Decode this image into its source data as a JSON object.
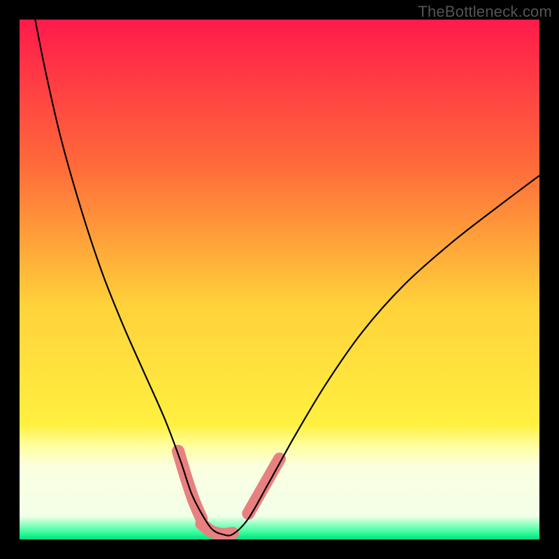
{
  "watermark": "TheBottleneck.com",
  "chart_data": {
    "type": "line",
    "title": "",
    "xlabel": "",
    "ylabel": "",
    "xlim": [
      0,
      100
    ],
    "ylim": [
      0,
      100
    ],
    "grid": false,
    "legend": false,
    "background_gradient": {
      "stops": [
        {
          "offset": 0.0,
          "color": "#ff1a4b"
        },
        {
          "offset": 0.28,
          "color": "#ff6a3a"
        },
        {
          "offset": 0.55,
          "color": "#ffd23a"
        },
        {
          "offset": 0.78,
          "color": "#fff040"
        },
        {
          "offset": 0.82,
          "color": "#ffffa0"
        },
        {
          "offset": 0.86,
          "color": "#fbffe0"
        },
        {
          "offset": 0.955,
          "color": "#f2ffe8"
        },
        {
          "offset": 0.985,
          "color": "#3fffa0"
        },
        {
          "offset": 1.0,
          "color": "#00e080"
        }
      ]
    },
    "series": [
      {
        "name": "bottleneck-curve",
        "color": "#000000",
        "width": 2.2,
        "x": [
          3,
          5,
          8,
          12,
          16,
          20,
          24,
          28,
          31,
          33,
          35,
          37,
          39,
          41,
          44,
          48,
          53,
          59,
          66,
          74,
          83,
          92,
          100
        ],
        "y": [
          100,
          90,
          77,
          63,
          51,
          41,
          32,
          23,
          15,
          9,
          5,
          2,
          1,
          1,
          4,
          11,
          20,
          30,
          40,
          49,
          57,
          64,
          70
        ]
      }
    ],
    "annotations": [
      {
        "name": "highlight-left",
        "type": "thick-segment",
        "color": "#e98080",
        "width": 18,
        "x": [
          30.5,
          32.0,
          33.5,
          35.0
        ],
        "y": [
          17.0,
          12.0,
          7.5,
          4.0
        ]
      },
      {
        "name": "highlight-bottom",
        "type": "thick-segment",
        "color": "#e98080",
        "width": 18,
        "x": [
          35.0,
          37.0,
          39.0,
          41.0
        ],
        "y": [
          3.0,
          1.5,
          1.0,
          1.2
        ]
      },
      {
        "name": "highlight-right",
        "type": "thick-segment",
        "color": "#e98080",
        "width": 18,
        "x": [
          44.0,
          46.0,
          48.0,
          50.0
        ],
        "y": [
          5.0,
          8.5,
          12.0,
          15.5
        ]
      }
    ]
  }
}
